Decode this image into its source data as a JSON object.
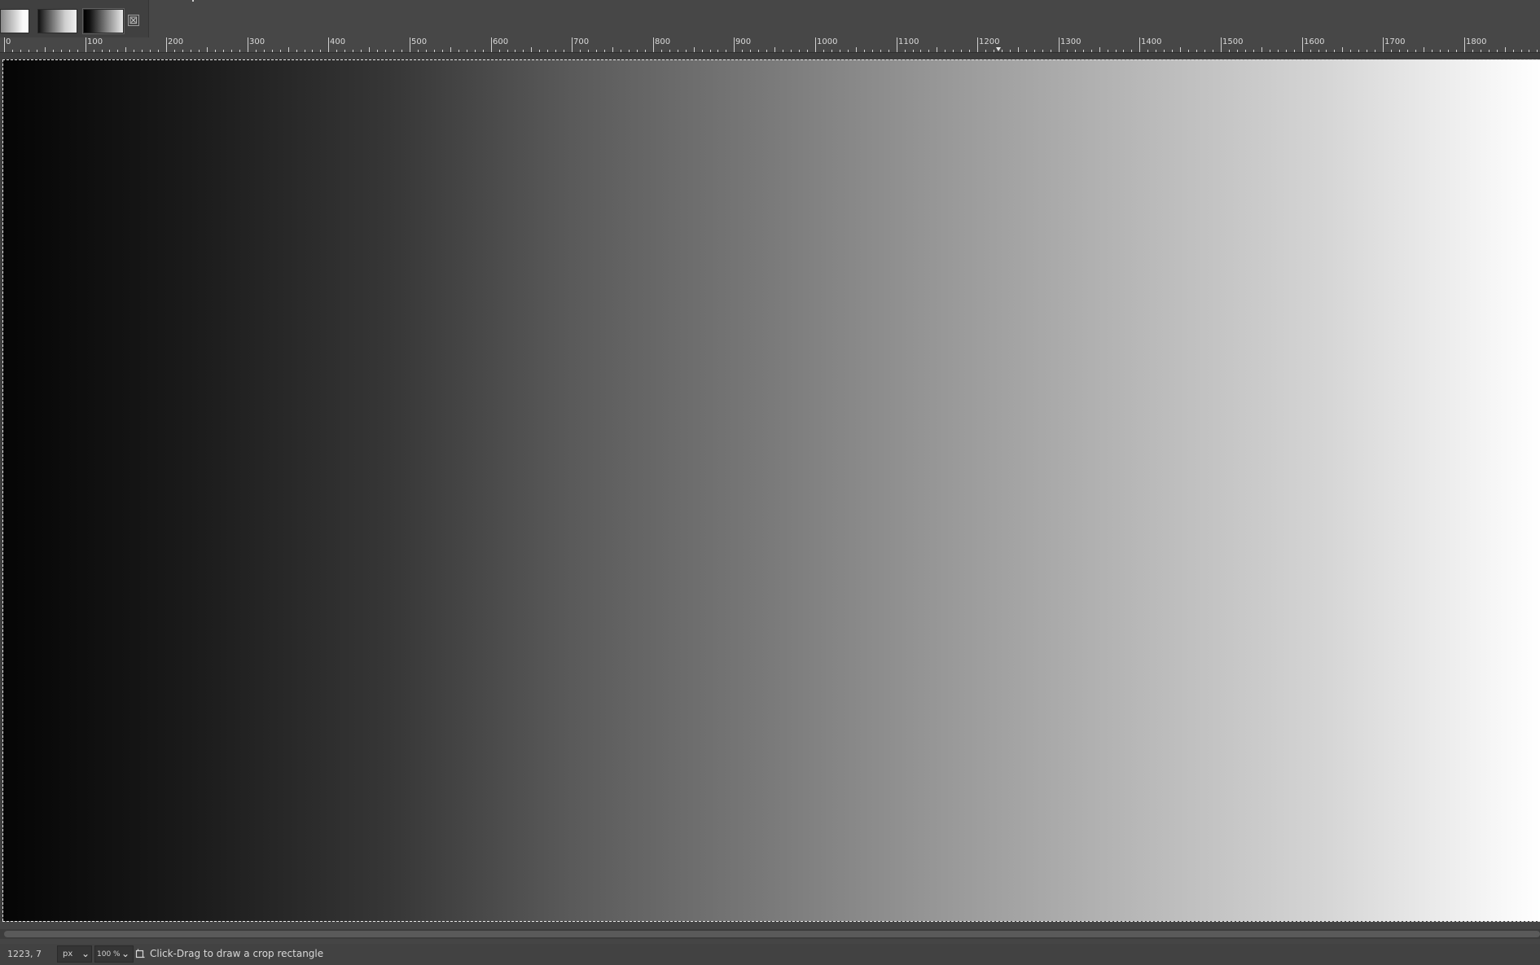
{
  "tabs": {
    "items": [
      {
        "name": "image-tab-1"
      },
      {
        "name": "image-tab-2"
      },
      {
        "name": "image-tab-3"
      }
    ],
    "close_glyph": "⊠"
  },
  "ruler": {
    "labels": [
      "0",
      "100",
      "200",
      "300",
      "400",
      "500",
      "600",
      "700",
      "800",
      "900",
      "1000",
      "1100",
      "1200",
      "1300",
      "1400",
      "1500",
      "1600",
      "1700",
      "1800"
    ]
  },
  "status": {
    "coords": "1223, 7",
    "unit": "px",
    "zoom": "100 %",
    "hint": "Click-Drag to draw a crop rectangle"
  },
  "icons": {
    "chevron": "chevron-down-icon",
    "crop": "crop-icon",
    "close": "close-icon"
  }
}
